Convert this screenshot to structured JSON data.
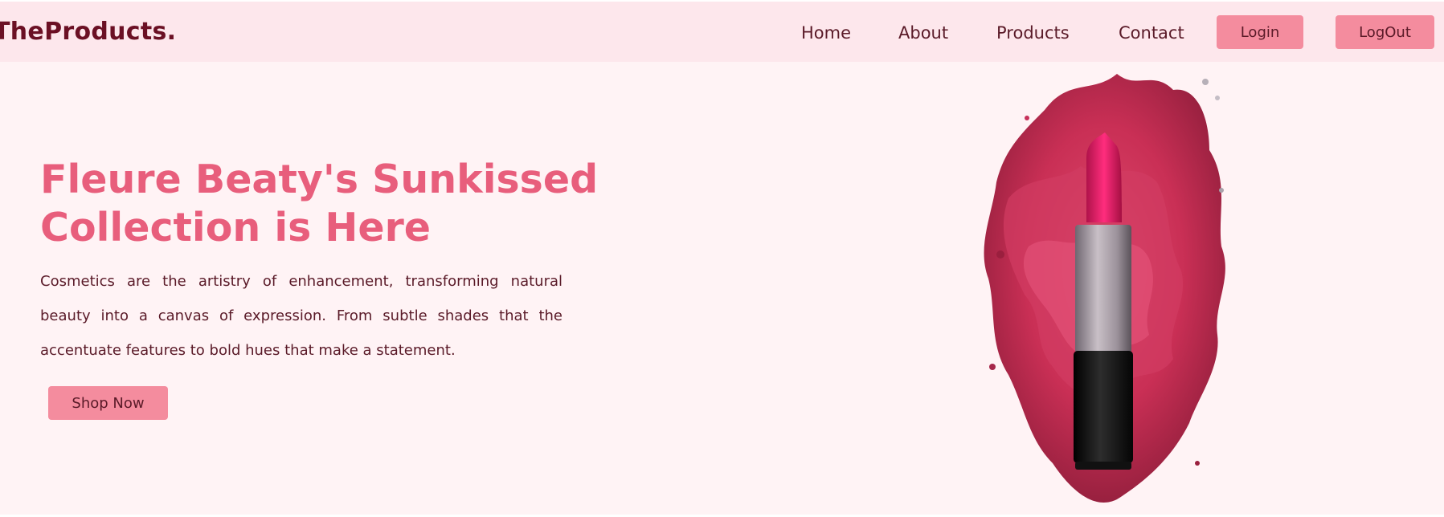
{
  "nav": {
    "brand": "TheProducts.",
    "links": [
      "Home",
      "About",
      "Products",
      "Contact"
    ],
    "login_label": "Login",
    "logout_label": "LogOut"
  },
  "hero": {
    "headline": "Fleure Beaty's Sunkissed Collection is Here",
    "paragraph": "Cosmetics are the artistry of enhancement, transforming natural beauty into a canvas of expression. From subtle shades that the accentuate features to bold hues that make a statement.",
    "cta_label": "Shop Now",
    "image": "lipstick-with-pink-paint-splash"
  },
  "colors": {
    "nav_bg": "#fde7ec",
    "hero_bg": "#fff3f5",
    "accent": "#e85e7c",
    "button": "#f48c9e",
    "text_dark": "#5a1a28"
  }
}
